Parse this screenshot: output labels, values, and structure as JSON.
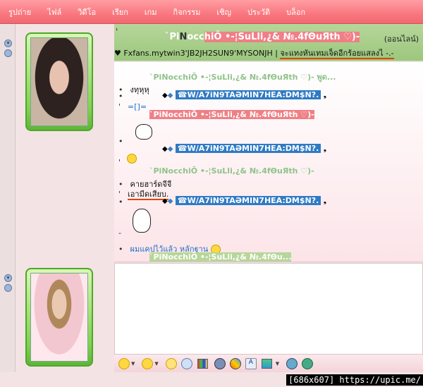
{
  "menu": [
    "รูปถ่าย",
    "ไฟล์",
    "วิดีโอ",
    "เรียก",
    "เกม",
    "กิจกรรม",
    "เชิญ",
    "ประวัติ",
    "บล็อก"
  ],
  "header": {
    "nick_prefix": "`Pi",
    "nick_a": "N",
    "nick_b": "occ",
    "nick_c": "hiŌ •-¦SuLli,¿& №.4fΘuЯth ♡)-",
    "status": "(ออนไลน์)",
    "tick": "'",
    "psm_a": "♥ Fxfans.mytwin3'JB2JH2SUN9'MYSONJH | ",
    "psm_b": "จะแทงหันเทมเจ็ดอีกร้อยแสลงไ -.-"
  },
  "conversation": {
    "sender_top": "`PiNocchiŌ •-¦SuLli,¿& №.4fΘuЯth ♡)-  พูด...",
    "msg1": "งทุหุหุ",
    "blue_name": "☎W/A7iN9TAƏMIN7HEA:DM$N?.",
    "msg2": "=[]=",
    "sender_mid": "`PiNocchiŌ •-¦SuLli,¿& №.4fΘuЯth ♡)-",
    "msg3": "คายฮาร์ดจีจี",
    "msg4": "เอามีดเสียบ.",
    "msg5": "ผมแคปไว้แล้ว หลักฐาน",
    "sender_bot": "`PiNocchiŌ •-¦SuLli,¿& №.4fΘu...",
    "bullets": [
      "•",
      "•",
      "'",
      "•",
      "'",
      "•",
      "'",
      "•",
      "-",
      "•",
      "•",
      "•"
    ]
  },
  "watermark": "[686x607] https://upic.me/",
  "colors": {
    "menu": "#f9777f",
    "header": "#9cc77d",
    "avatar_border": "#4ea82c",
    "name_box": "#2f7ac4"
  },
  "toolbar_icons": [
    "emoticon-icon",
    "wink-icon",
    "nudge-icon",
    "voice-clip-icon",
    "background-icon",
    "winks-icon",
    "games-icon",
    "font-icon",
    "color-icon",
    "block-icon",
    "snapshot-icon"
  ]
}
